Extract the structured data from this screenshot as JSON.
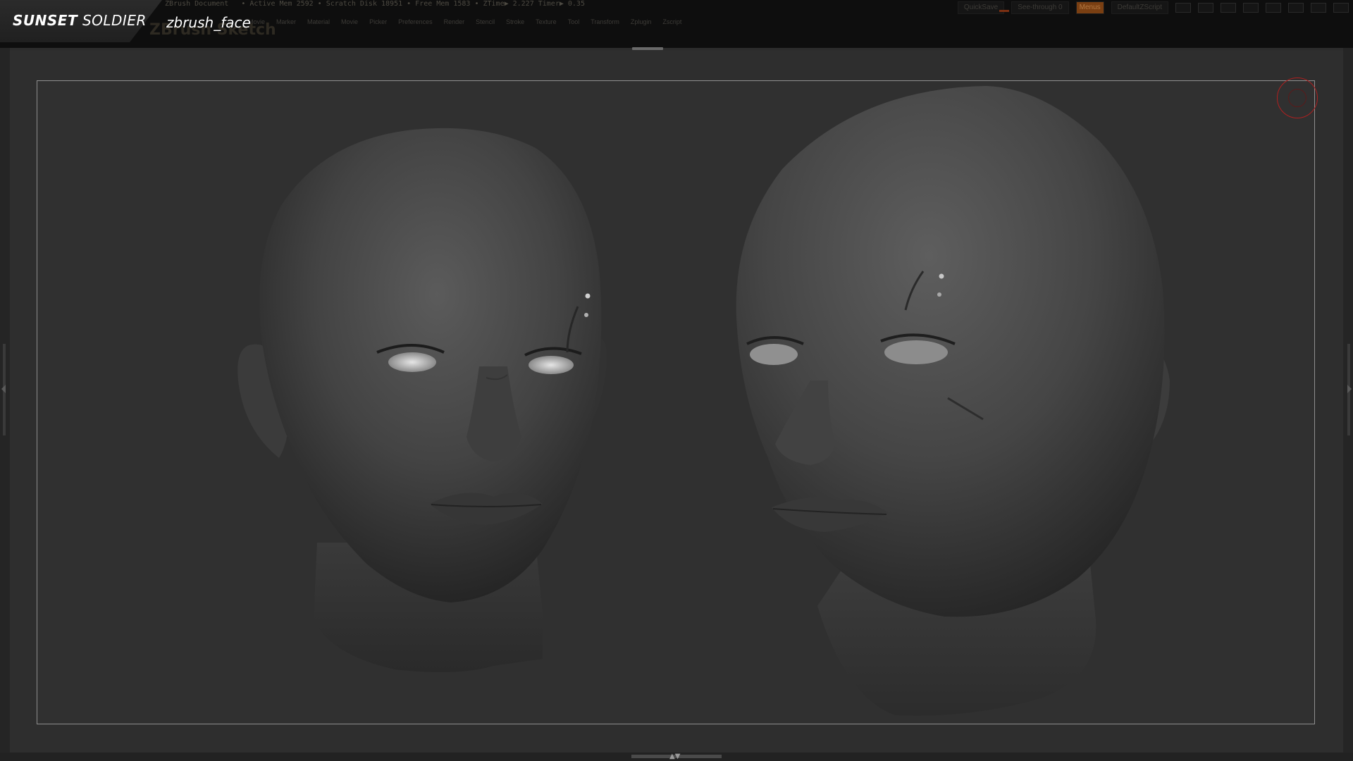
{
  "branding": {
    "word1": "SUNSET",
    "word2": "SOLDIER"
  },
  "document": {
    "name": "zbrush_face",
    "ghost_title": "ZBrush Sketch"
  },
  "status_bar": {
    "items": [
      "ZBrush Document",
      "• Active Mem 2592 • Scratch Disk 18951 • Free Mem 1583 • ZTime▶ 2.227  Timer▶ 0.35"
    ]
  },
  "menu_bar": {
    "items": [
      "Movie",
      "Marker",
      "Material",
      "Movie",
      "Picker",
      "Preferences",
      "Render",
      "Stencil",
      "Stroke",
      "Texture",
      "Tool",
      "Transform",
      "Zplugin",
      "Zscript"
    ]
  },
  "top_right": {
    "quicksave_label": "QuickSave",
    "seethrough_label": "See-through  0",
    "menus_label": "Menus",
    "script_label": "DefaultZScript"
  },
  "viewport": {
    "bottom_arrows": "▲▼"
  },
  "colors": {
    "background": "#2c2c2c",
    "frame_border": "#8f8f8f",
    "accent_orange": "#7a3f12",
    "cursor_red": "#b02020"
  },
  "icons": {
    "brush_cursor": "circle-brush-cursor-icon"
  }
}
